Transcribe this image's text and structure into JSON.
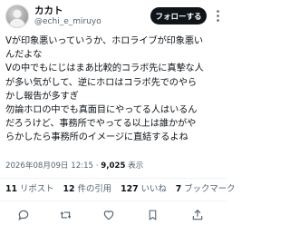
{
  "author": {
    "name": "カカト",
    "handle": "@echi_e_miruyo",
    "avatar_icon": "user-avatar"
  },
  "follow_button": {
    "label": "フォローする"
  },
  "post": {
    "lines": [
      "Vが印象悪いっていうか、ホロライブが印象悪い",
      "んだよな",
      "Vの中でもにじはまあ比較的コラボ先に真摯な人",
      "が多い気がして、逆にホロはコラボ先でのやら",
      "かし報告が多すぎ",
      "勿論ホロの中でも真面目にやってる人はいるん",
      "だろうけど、事務所でやってる以上は誰かがや",
      "らかしたら事務所のイメージに直結するよね"
    ]
  },
  "meta": {
    "timestamp": "2026年08月09日 12:15",
    "separator": "·",
    "views_count": "9,025",
    "views_label": "表示"
  },
  "stats": [
    {
      "count": "11",
      "label": "リポスト"
    },
    {
      "count": "12",
      "label": "件の引用"
    },
    {
      "count": "127",
      "label": "いいね"
    },
    {
      "count": "7",
      "label": "ブックマーク"
    }
  ],
  "colors": {
    "text": "#0f1419",
    "secondary": "#536471",
    "divider": "#eff3f4",
    "button_bg": "#0f1419"
  },
  "icons": [
    "more-icon",
    "reply-icon",
    "repost-icon",
    "like-icon",
    "bookmark-icon",
    "share-icon"
  ]
}
